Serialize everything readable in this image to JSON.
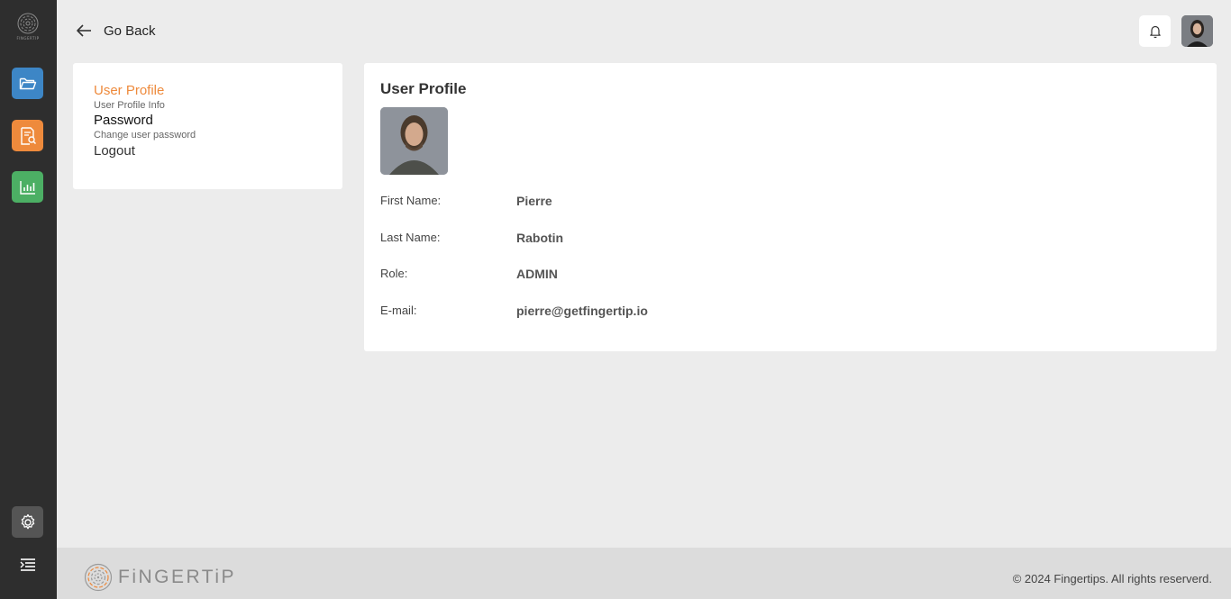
{
  "brand": {
    "logo_text": "FINGERTIP",
    "footer_logo_text": "FiNGERTiP"
  },
  "sidebar": {
    "items": [
      {
        "name": "files",
        "icon": "folder-open-icon",
        "color": "#3d86c6"
      },
      {
        "name": "reports",
        "icon": "report-search-icon",
        "color": "#ee8a3c"
      },
      {
        "name": "analytics",
        "icon": "bar-chart-icon",
        "color": "#4caf64"
      },
      {
        "name": "settings",
        "icon": "gear-icon",
        "color": "#555555"
      },
      {
        "name": "menu",
        "icon": "menu-indent-icon"
      }
    ]
  },
  "header": {
    "go_back_label": "Go Back"
  },
  "menu": {
    "profile_label": "User Profile",
    "profile_sub": "User Profile Info",
    "password_label": "Password",
    "password_sub": "Change user password",
    "logout_label": "Logout",
    "active_color": "#ee8a3c"
  },
  "profile": {
    "title": "User Profile",
    "fields": [
      {
        "label": "First Name:",
        "value": "Pierre"
      },
      {
        "label": "Last Name:",
        "value": "Rabotin"
      },
      {
        "label": "Role:",
        "value": "ADMIN"
      },
      {
        "label": "E-mail:",
        "value": "pierre@getfingertip.io"
      }
    ]
  },
  "footer": {
    "copyright": "© 2024 Fingertips. All rights reserverd."
  }
}
